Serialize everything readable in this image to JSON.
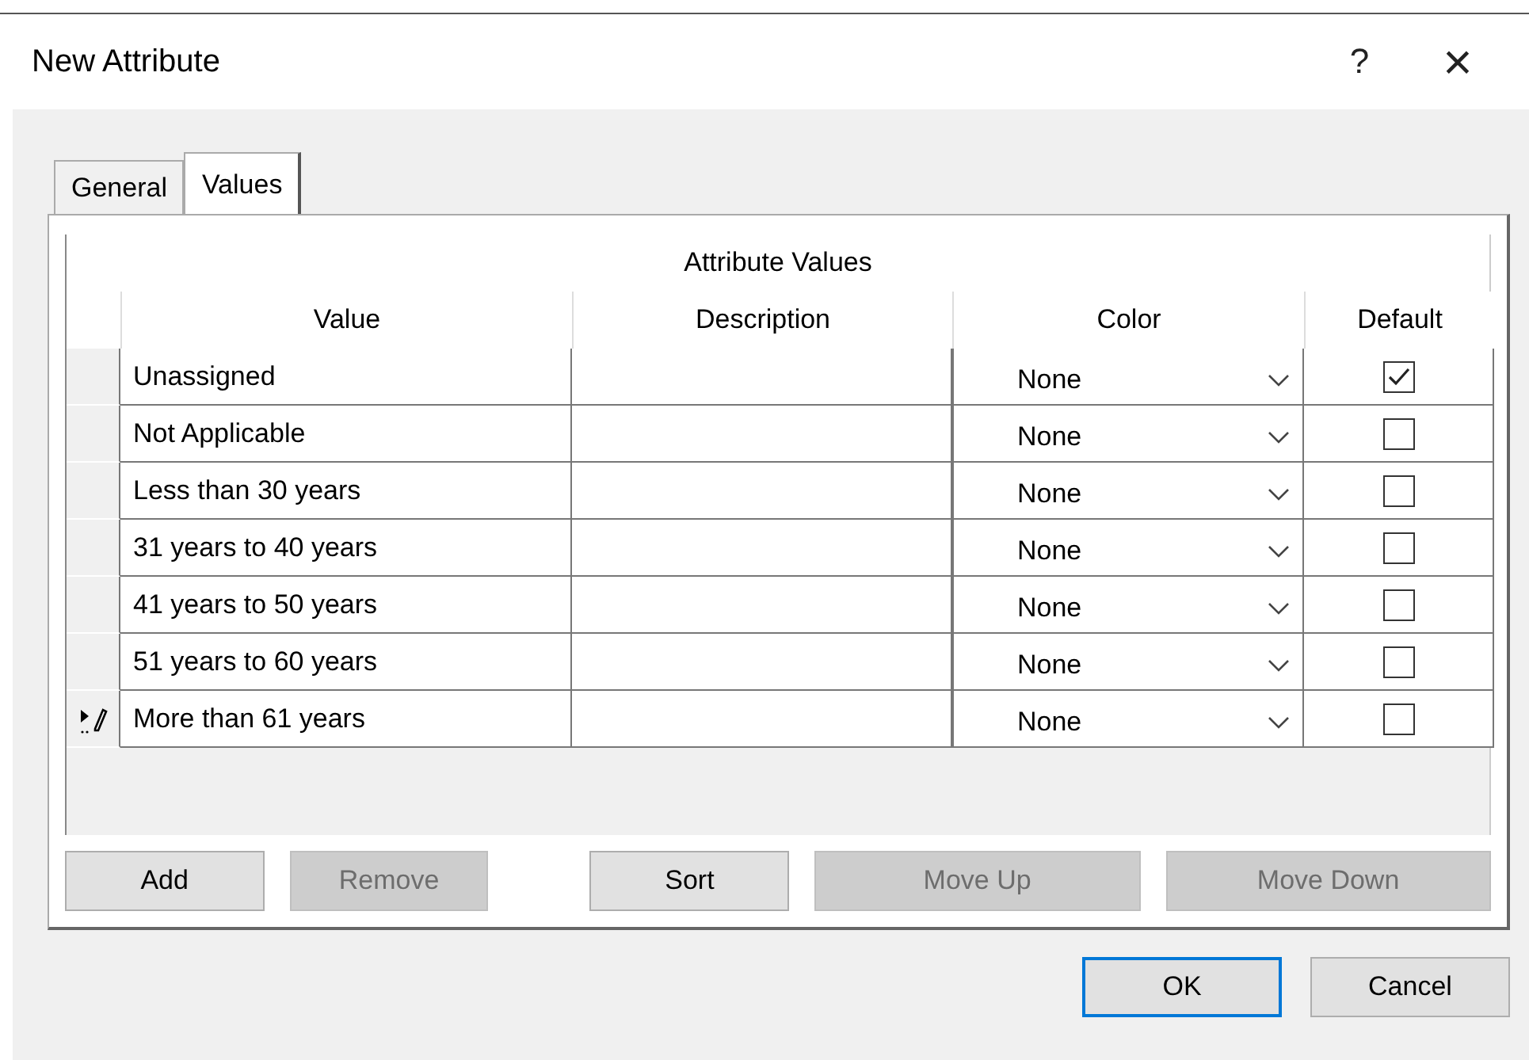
{
  "window": {
    "title": "New Attribute",
    "help": "?",
    "close": "×"
  },
  "tabs": [
    {
      "label": "General",
      "selected": false
    },
    {
      "label": "Values",
      "selected": true
    }
  ],
  "grid": {
    "caption": "Attribute Values",
    "columns": [
      "Value",
      "Description",
      "Color",
      "Default"
    ],
    "rows": [
      {
        "value": "Unassigned",
        "color_choice": "None",
        "default": true,
        "editing": false
      },
      {
        "value": "Not Applicable",
        "color_choice": "None",
        "default": false,
        "editing": false
      },
      {
        "value": "Less than 30 years",
        "color_choice": "None",
        "default": false,
        "editing": false
      },
      {
        "value": "31 years to 40 years",
        "color_choice": "None",
        "default": false,
        "editing": false
      },
      {
        "value": "41 years to 50 years",
        "color_choice": "None",
        "default": false,
        "editing": false
      },
      {
        "value": "51 years to 60 years",
        "color_choice": "None",
        "default": false,
        "editing": false
      },
      {
        "value": "More than 61 years",
        "color_choice": "None",
        "default": false,
        "editing": true
      }
    ]
  },
  "grid_buttons": [
    {
      "label": "Add",
      "disabled": false
    },
    {
      "label": "Remove",
      "disabled": true
    },
    {
      "label": "Sort",
      "disabled": false
    },
    {
      "label": "Move Up",
      "disabled": true
    },
    {
      "label": "Move Down",
      "disabled": true
    }
  ],
  "dialog_buttons": [
    {
      "label": "OK",
      "default": true
    },
    {
      "label": "Cancel",
      "default": false
    }
  ]
}
